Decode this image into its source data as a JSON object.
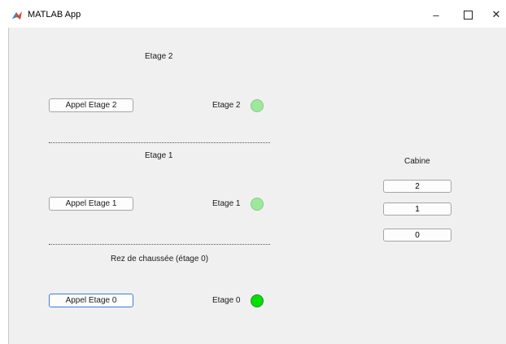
{
  "window": {
    "title": "MATLAB App",
    "minimize_glyph": "–",
    "close_glyph": "✕"
  },
  "floors": {
    "etage2": {
      "section_title": "Etage 2",
      "call_button": "Appel Etage 2",
      "lamp_label": "Etage 2",
      "lamp_color": "#9ee89c",
      "lamp_state": "off"
    },
    "etage1": {
      "section_title": "Etage 1",
      "call_button": "Appel Etage 1",
      "lamp_label": "Etage 1",
      "lamp_color": "#9ee89c",
      "lamp_state": "off"
    },
    "etage0": {
      "section_title": "Rez de chaussée (étage 0)",
      "call_button": "Appel Etage 0",
      "lamp_label": "Etage 0",
      "lamp_color": "#00e000",
      "lamp_state": "on"
    }
  },
  "cabine": {
    "title": "Cabine",
    "buttons": [
      "2",
      "1",
      "0"
    ]
  }
}
